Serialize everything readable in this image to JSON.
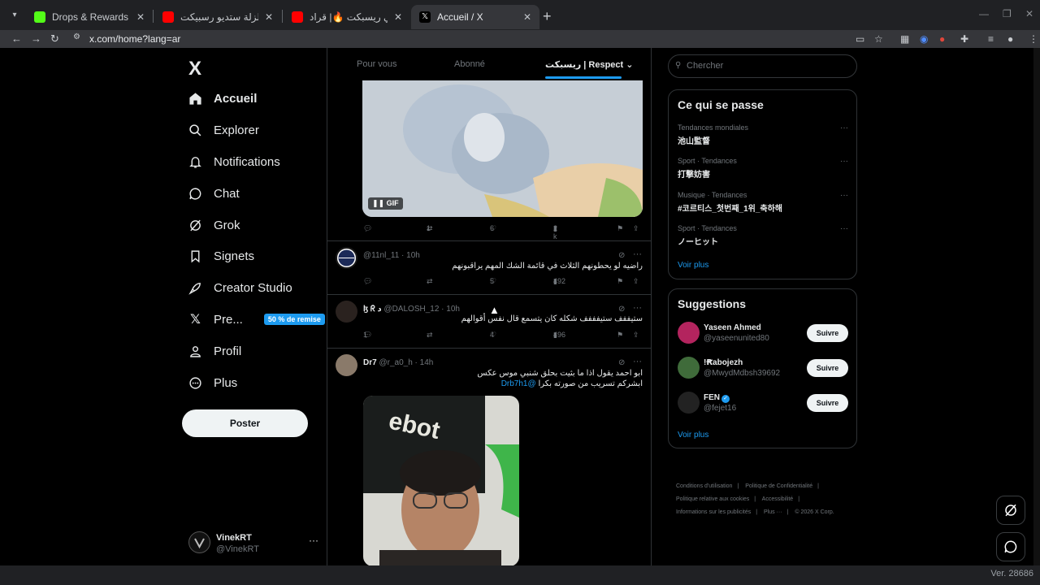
{
  "browser": {
    "tabs": [
      {
        "title": "Drops & Rewards Inventory - K",
        "favicon_color": "#53fc18",
        "active": false
      },
      {
        "title": "راب بارود الزلزلة ستديو رسبيكت |",
        "favicon_color": "#ff0000",
        "active": false
      },
      {
        "title": "فايت بقاله في ريسبكت 🔥| قراد",
        "favicon_color": "#ff0000",
        "active": false
      },
      {
        "title": "Accueil / X",
        "favicon_color": "#000000",
        "active": true
      }
    ],
    "url": "x.com/home?lang=ar"
  },
  "leftnav": {
    "logo": "X",
    "items": [
      {
        "label": "Accueil",
        "icon": "home-icon"
      },
      {
        "label": "Explorer",
        "icon": "search-icon"
      },
      {
        "label": "Notifications",
        "icon": "bell-icon"
      },
      {
        "label": "Chat",
        "icon": "chat-icon"
      },
      {
        "label": "Grok",
        "icon": "grok-icon"
      },
      {
        "label": "Signets",
        "icon": "bookmark-icon"
      },
      {
        "label": "Creator Studio",
        "icon": "rocket-icon"
      },
      {
        "label": "Pre...",
        "icon": "x-icon"
      },
      {
        "label": "Profil",
        "icon": "user-icon"
      },
      {
        "label": "Plus",
        "icon": "more-circle-icon"
      }
    ],
    "promo_badge": "50 % de remise",
    "post_button": "Poster",
    "account": {
      "name": "VinekRT",
      "handle": "@VinekRT"
    }
  },
  "feed": {
    "tabs": [
      "Pour vous",
      "Abonné",
      "ريسبكت | Respect"
    ],
    "gif_label": "GIF",
    "first_post_actions": {
      "replies": "",
      "reposts": "1",
      "likes": "6",
      "views": "2 k"
    },
    "posts": [
      {
        "name": "",
        "handle": "@11nl_11",
        "time": "10h",
        "text": "راضيه لو يحطونهم الثلاث في قائمة الشك المهم يراقبونهم",
        "replies": "",
        "reposts": "",
        "likes": "5",
        "views": "492"
      },
      {
        "name": "ɮ ᖇ د",
        "handle": "@DALOSH_12",
        "time": "10h",
        "text": "ستيففف ستيفففف شكله كان يتسمع قال نفس أقوالهم",
        "replies": "1",
        "reposts": "",
        "likes": "4",
        "views": "496"
      },
      {
        "name": "Dr7",
        "handle": "@r_a0_h",
        "time": "14h",
        "text_line1": "ابو احمد يقول اذا ما بثيت بحلق شنبي موس عكس",
        "text_line2": "ابشركم تسريب من صورته بكرا",
        "mention": "@Drb7h1"
      }
    ]
  },
  "right": {
    "search_placeholder": "Chercher",
    "trending": {
      "title": "Ce qui se passe",
      "items": [
        {
          "category": "Tendances mondiales",
          "title": "池山監督"
        },
        {
          "category": "Sport · Tendances",
          "title": "打撃妨害"
        },
        {
          "category": "Musique · Tendances",
          "title": "#코르티스_첫번째_1위_축하해"
        },
        {
          "category": "Sport · Tendances",
          "title": "ノーヒット"
        }
      ],
      "see_more": "Voir plus"
    },
    "suggestions": {
      "title": "Suggestions",
      "items": [
        {
          "name": "Yaseen Ahmed",
          "handle": "@yaseenunited80",
          "verified": false,
          "avatar_color": "#b3245e"
        },
        {
          "name": "!Ꞧabojezh",
          "handle": "@MwydMdbsh39692",
          "verified": false,
          "avatar_color": "#3f6b3a"
        },
        {
          "name": "FEN",
          "handle": "@fejet16",
          "verified": true,
          "avatar_color": "#222222"
        }
      ],
      "follow_label": "Suivre",
      "see_more": "Voir plus"
    },
    "footer": {
      "links": [
        "Conditions d'utilisation",
        "Politique de Confidentialité",
        "Politique relative aux cookies",
        "Accessibilité",
        "Informations sur les publicités",
        "Plus ···",
        "© 2026 X Corp."
      ]
    }
  },
  "status": {
    "version": "Ver. 28686"
  },
  "colors": {
    "accent": "#1d9bf0",
    "background": "#000000",
    "border": "#2f3336",
    "muted": "#71767b"
  }
}
